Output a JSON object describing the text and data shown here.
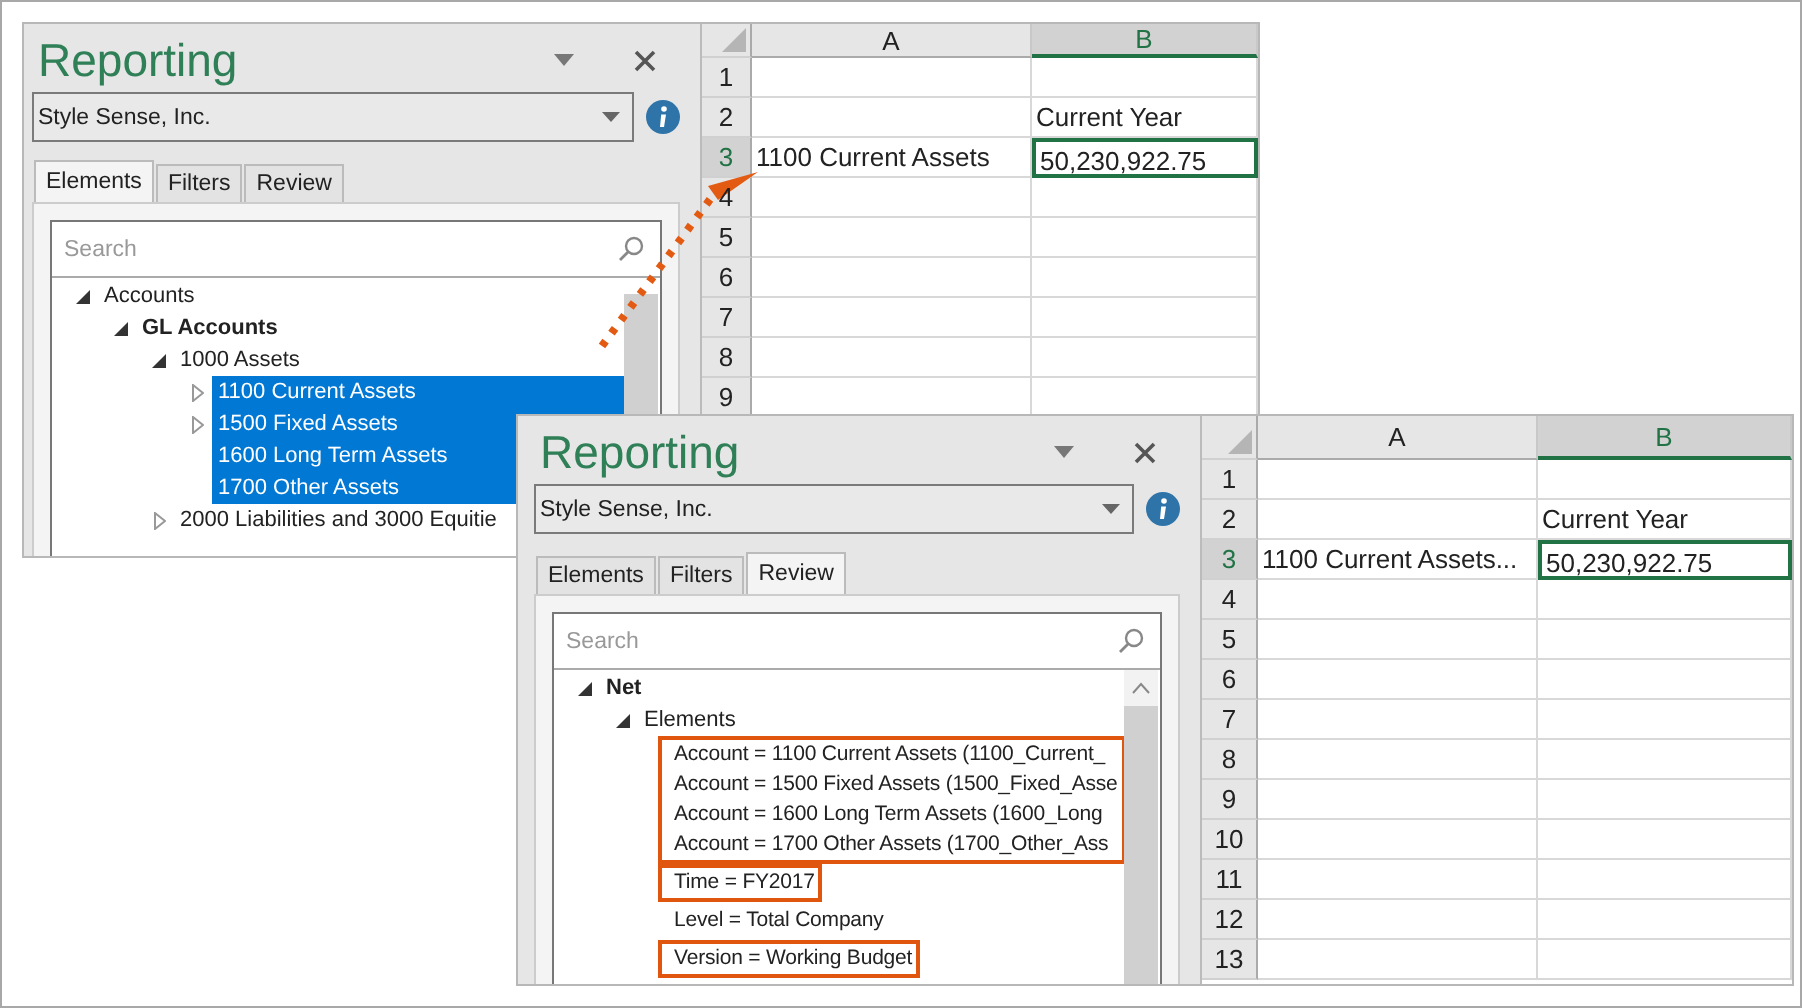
{
  "snapshots": [
    {
      "pane": {
        "title": "Reporting",
        "company": "Style Sense, Inc.",
        "tabs": [
          {
            "label": "Elements",
            "selected": true
          },
          {
            "label": "Filters",
            "selected": false
          },
          {
            "label": "Review",
            "selected": false
          }
        ],
        "search": {
          "placeholder": "Search"
        },
        "tree": [
          {
            "label": "Accounts",
            "expanded": true,
            "selected": false,
            "children": [
              {
                "label": "GL Accounts",
                "bold": true,
                "expanded": true,
                "selected": false,
                "children": [
                  {
                    "label": "1000 Assets",
                    "expanded": true,
                    "selected": false,
                    "children": [
                      {
                        "label": "1100 Current Assets",
                        "expanded": false,
                        "selected": true
                      },
                      {
                        "label": "1500 Fixed Assets",
                        "expanded": false,
                        "selected": true
                      },
                      {
                        "label": "1600 Long Term Assets",
                        "selected": true
                      },
                      {
                        "label": "1700 Other Assets",
                        "selected": true
                      }
                    ]
                  },
                  {
                    "label": "2000 Liabilities and 3000 Equitie",
                    "expanded": false,
                    "selected": false
                  }
                ]
              }
            ]
          }
        ]
      },
      "sheet": {
        "columns": [
          {
            "label": "A",
            "selected": false
          },
          {
            "label": "B",
            "selected": true
          }
        ],
        "rows": [
          {
            "number": "1",
            "selected": false
          },
          {
            "number": "2",
            "selected": false,
            "b": "Current Year"
          },
          {
            "number": "3",
            "selected": true,
            "a": "1100 Current Assets",
            "b": "50,230,922.75"
          },
          {
            "number": "4",
            "selected": false
          },
          {
            "number": "5",
            "selected": false
          },
          {
            "number": "6",
            "selected": false
          },
          {
            "number": "7",
            "selected": false
          },
          {
            "number": "8",
            "selected": false
          },
          {
            "number": "9",
            "selected": false
          }
        ]
      }
    },
    {
      "pane": {
        "title": "Reporting",
        "company": "Style Sense, Inc.",
        "tabs": [
          {
            "label": "Elements",
            "selected": false
          },
          {
            "label": "Filters",
            "selected": false
          },
          {
            "label": "Review",
            "selected": true
          }
        ],
        "search": {
          "placeholder": "Search"
        },
        "tree": [
          {
            "label": "Net",
            "bold": true,
            "expanded": true,
            "selected": false,
            "children": [
              {
                "label": "Elements",
                "expanded": true,
                "selected": false,
                "children": [
                  {
                    "kind": "group",
                    "highlighted": true,
                    "items": [
                      "Account = 1100 Current Assets (1100_Current_",
                      "Account = 1500 Fixed Assets (1500_Fixed_Asse",
                      "Account = 1600 Long Term Assets (1600_Long",
                      "Account = 1700 Other Assets (1700_Other_Ass"
                    ]
                  },
                  {
                    "kind": "group",
                    "highlighted": true,
                    "items": [
                      "Time = FY2017"
                    ]
                  },
                  {
                    "kind": "group",
                    "highlighted": false,
                    "items": [
                      "Level = Total Company"
                    ]
                  },
                  {
                    "kind": "group",
                    "highlighted": true,
                    "items": [
                      "Version = Working Budget"
                    ]
                  }
                ]
              }
            ]
          }
        ]
      },
      "sheet": {
        "columns": [
          {
            "label": "A",
            "selected": false
          },
          {
            "label": "B",
            "selected": true
          }
        ],
        "rows": [
          {
            "number": "1",
            "selected": false
          },
          {
            "number": "2",
            "selected": false,
            "b": "Current Year"
          },
          {
            "number": "3",
            "selected": true,
            "a": "1100 Current Assets...",
            "b": "50,230,922.75"
          },
          {
            "number": "4",
            "selected": false
          },
          {
            "number": "5",
            "selected": false
          },
          {
            "number": "6",
            "selected": false
          },
          {
            "number": "7",
            "selected": false
          },
          {
            "number": "8",
            "selected": false
          },
          {
            "number": "9",
            "selected": false
          },
          {
            "number": "10",
            "selected": false
          },
          {
            "number": "11",
            "selected": false
          },
          {
            "number": "12",
            "selected": false
          },
          {
            "number": "13",
            "selected": false
          }
        ]
      }
    }
  ]
}
